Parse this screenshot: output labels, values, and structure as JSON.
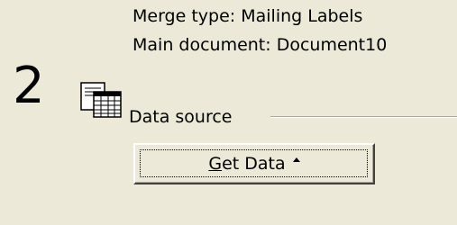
{
  "merge_info": {
    "merge_type": "Merge type: Mailing Labels",
    "main_document": "Main document: Document10"
  },
  "step": {
    "number": "2",
    "section_label": "Data source",
    "icon": "data-table-document-icon"
  },
  "get_data_button": {
    "accel": "G",
    "label_rest": "et Data",
    "indicator": "dropdown-caret-icon"
  }
}
